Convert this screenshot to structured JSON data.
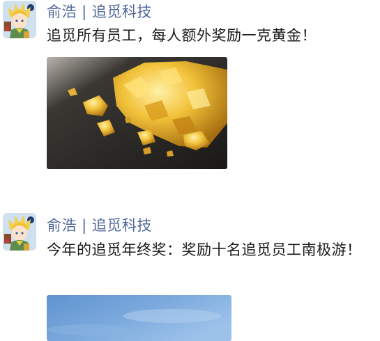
{
  "posts": [
    {
      "author": "俞浩 | 追觅科技",
      "text": "追觅所有员工，每人额外奖励一克黄金！",
      "avatar_icon": "anime-boy-avatar-icon",
      "image_subject": "gold-nuggets-photo"
    },
    {
      "author": "俞浩 | 追觅科技",
      "text": "今年的追觅年终奖：奖励十名追觅员工南极游！",
      "avatar_icon": "anime-boy-avatar-icon",
      "image_subject": "sky-photo"
    }
  ],
  "colors": {
    "author": "#4f6899",
    "text": "#1a1a1a",
    "background": "#ffffff"
  }
}
